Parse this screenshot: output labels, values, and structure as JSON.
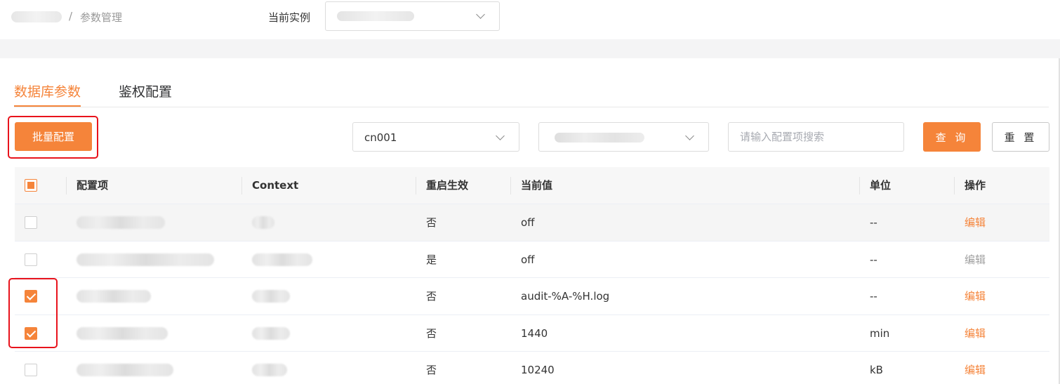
{
  "breadcrumb": {
    "parent": "",
    "separator": "/",
    "current": "参数管理"
  },
  "instance": {
    "label": "当前实例",
    "value": ""
  },
  "tabs": [
    {
      "label": "数据库参数",
      "active": true
    },
    {
      "label": "鉴权配置",
      "active": false
    }
  ],
  "toolbar": {
    "batch_label": "批量配置",
    "node_select": "cn001",
    "ip_select": "",
    "search_placeholder": "请输入配置项搜索",
    "query_label": "查 询",
    "reset_label": "重 置"
  },
  "table": {
    "headers": [
      "配置项",
      "Context",
      "重启生效",
      "当前值",
      "单位",
      "操作"
    ],
    "header_checkbox": "partial",
    "rows": [
      {
        "checked": false,
        "name": "",
        "context": "",
        "restart": "否",
        "value": "off",
        "unit": "--",
        "action": "编辑",
        "action_enabled": true
      },
      {
        "checked": false,
        "name": "",
        "context": "",
        "restart": "是",
        "value": "off",
        "unit": "--",
        "action": "编辑",
        "action_enabled": false
      },
      {
        "checked": true,
        "name": "",
        "context": "",
        "restart": "否",
        "value": "audit-%A-%H.log",
        "unit": "--",
        "action": "编辑",
        "action_enabled": true
      },
      {
        "checked": true,
        "name": "",
        "context": "",
        "restart": "否",
        "value": "1440",
        "unit": "min",
        "action": "编辑",
        "action_enabled": true
      },
      {
        "checked": false,
        "name": "",
        "context": "",
        "restart": "否",
        "value": "10240",
        "unit": "kB",
        "action": "编辑",
        "action_enabled": true
      }
    ]
  },
  "colors": {
    "accent": "#f5843a",
    "highlight_box": "#e8131c",
    "header_bg": "#f7f7f7",
    "disabled_link": "#a0a0a0"
  }
}
